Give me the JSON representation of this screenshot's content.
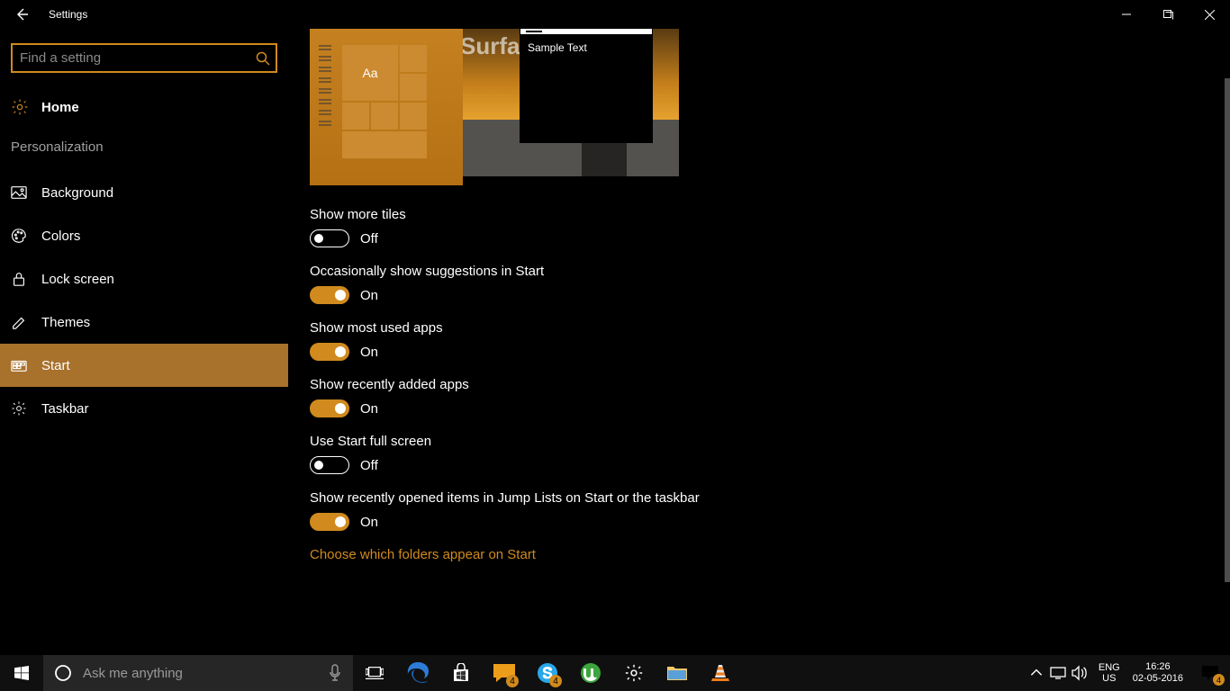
{
  "titlebar": {
    "title": "Settings"
  },
  "search": {
    "placeholder": "Find a setting"
  },
  "home": {
    "label": "Home"
  },
  "category": "Personalization",
  "nav": [
    {
      "key": "background",
      "label": "Background",
      "active": false
    },
    {
      "key": "colors",
      "label": "Colors",
      "active": false
    },
    {
      "key": "lock-screen",
      "label": "Lock screen",
      "active": false
    },
    {
      "key": "themes",
      "label": "Themes",
      "active": false
    },
    {
      "key": "start",
      "label": "Start",
      "active": true
    },
    {
      "key": "taskbar",
      "label": "Taskbar",
      "active": false
    }
  ],
  "preview": {
    "tile_text": "Aa",
    "window_text": "Sample Text",
    "wall_text": "MicrosoftSurfac"
  },
  "toggle_labels": {
    "on": "On",
    "off": "Off"
  },
  "settings": [
    {
      "key": "show-more-tiles",
      "label": "Show more tiles",
      "on": false
    },
    {
      "key": "suggestions",
      "label": "Occasionally show suggestions in Start",
      "on": true
    },
    {
      "key": "most-used",
      "label": "Show most used apps",
      "on": true
    },
    {
      "key": "recently-added",
      "label": "Show recently added apps",
      "on": true
    },
    {
      "key": "full-screen",
      "label": "Use Start full screen",
      "on": false
    },
    {
      "key": "jump-lists",
      "label": "Show recently opened items in Jump Lists on Start or the taskbar",
      "on": true
    }
  ],
  "link": "Choose which folders appear on Start",
  "taskbar": {
    "search_placeholder": "Ask me anything",
    "lang_top": "ENG",
    "lang_bot": "US",
    "time": "16:26",
    "date": "02-05-2016",
    "action_badge": "4",
    "badges": {
      "messaging": "4",
      "skype": "4"
    }
  },
  "colors": {
    "accent": "#d08a1d",
    "accent_alt": "#a8712c"
  }
}
